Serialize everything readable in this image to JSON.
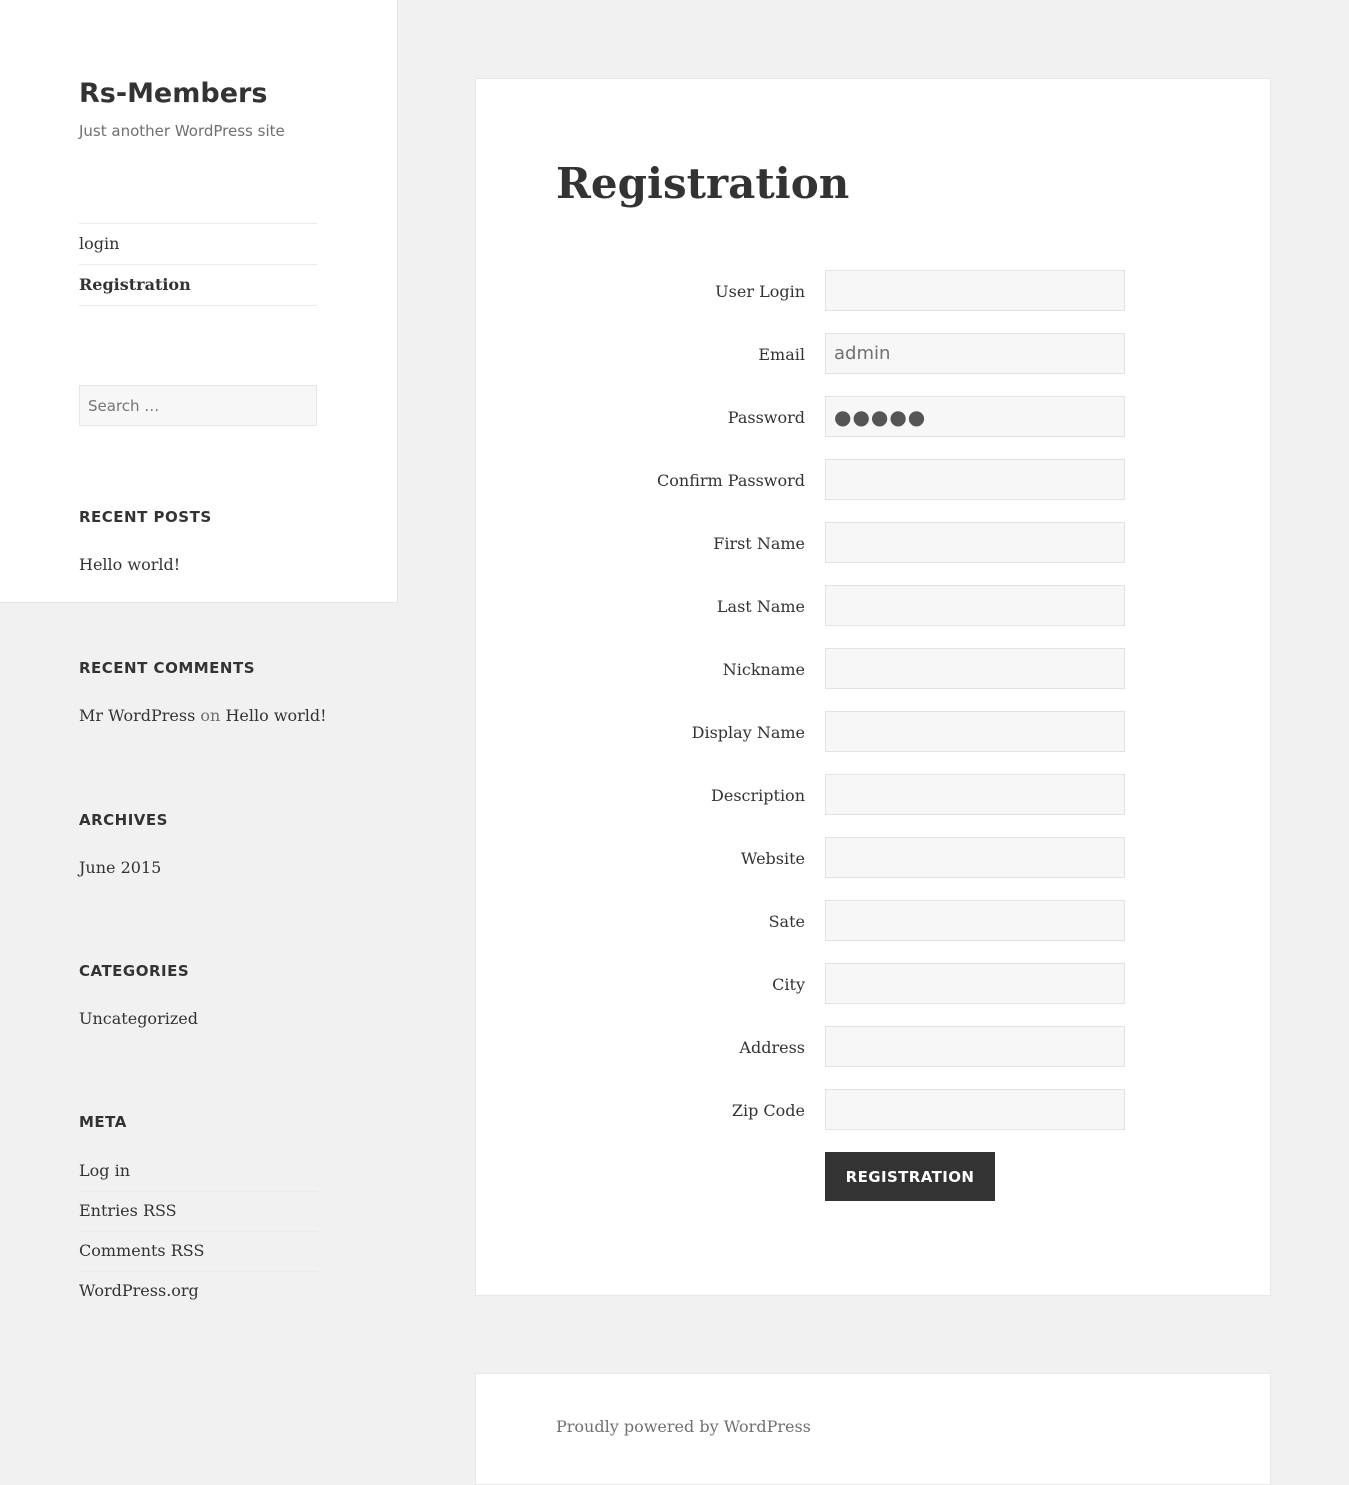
{
  "site": {
    "title": "Rs-Members",
    "description": "Just another WordPress site"
  },
  "nav": {
    "items": [
      {
        "label": "login"
      },
      {
        "label": "Registration"
      }
    ]
  },
  "search": {
    "placeholder": "Search …"
  },
  "widgets": {
    "recent_posts": {
      "title": "RECENT POSTS",
      "items": [
        "Hello world!"
      ]
    },
    "recent_comments": {
      "title": "RECENT COMMENTS",
      "author": "Mr WordPress",
      "on": "on",
      "post": "Hello world!"
    },
    "archives": {
      "title": "ARCHIVES",
      "items": [
        "June 2015"
      ]
    },
    "categories": {
      "title": "CATEGORIES",
      "items": [
        "Uncategorized"
      ]
    },
    "meta": {
      "title": "META",
      "items": [
        "Log in",
        "Entries RSS",
        "Comments RSS",
        "WordPress.org"
      ]
    }
  },
  "page": {
    "title": "Registration"
  },
  "form": {
    "fields": [
      {
        "label": "User Login",
        "value": ""
      },
      {
        "label": "Email",
        "value": "admin"
      },
      {
        "label": "Password",
        "value": "●●●●●"
      },
      {
        "label": "Confirm Password",
        "value": ""
      },
      {
        "label": "First Name",
        "value": ""
      },
      {
        "label": "Last Name",
        "value": ""
      },
      {
        "label": "Nickname",
        "value": ""
      },
      {
        "label": "Display Name",
        "value": ""
      },
      {
        "label": "Description",
        "value": ""
      },
      {
        "label": "Website",
        "value": ""
      },
      {
        "label": "Sate",
        "value": ""
      },
      {
        "label": "City",
        "value": ""
      },
      {
        "label": "Address",
        "value": ""
      },
      {
        "label": "Zip Code",
        "value": ""
      }
    ],
    "submit_label": "REGISTRATION"
  },
  "footer": {
    "text": "Proudly powered by WordPress"
  }
}
